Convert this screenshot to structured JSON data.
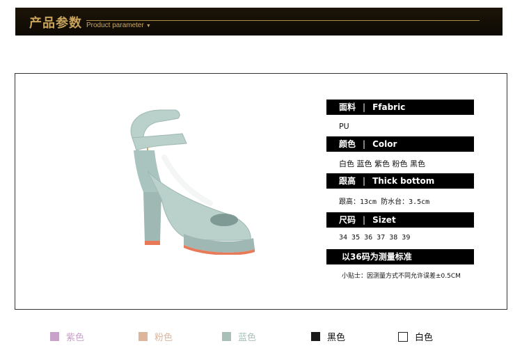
{
  "banner": {
    "title": "产品参数",
    "subtitle": "Product parameter",
    "arrow": "▼"
  },
  "params": [
    {
      "label_cn": "面料",
      "label_en": "Ffabric",
      "value": "PU"
    },
    {
      "label_cn": "颜色",
      "label_en": "Color",
      "value": "白色  蓝色  紫色  粉色  黑色"
    },
    {
      "label_cn": "跟高",
      "label_en": "Thick bottom",
      "value": "跟高：13cm   防水台：3.5cm"
    },
    {
      "label_cn": "尺码",
      "label_en": "Sizet",
      "value": "34  35  36  37  38  39"
    }
  ],
  "standard": {
    "title": "以36码为测量标准",
    "note": "小贴士：因测量方式不同允许误差±0.5CM"
  },
  "separator": "|",
  "swatches": [
    {
      "label": "紫色",
      "color": "#c8a2c8",
      "text_color": "#c8a2c8"
    },
    {
      "label": "粉色",
      "color": "#dcb59b",
      "text_color": "#dcb59b"
    },
    {
      "label": "蓝色",
      "color": "#a8c0b8",
      "text_color": "#a8c0b8"
    },
    {
      "label": "黑色",
      "color": "#1a1a1a",
      "text_color": "#111111"
    },
    {
      "label": "白色",
      "color": "#ffffff",
      "text_color": "#111111"
    }
  ],
  "colors": {
    "shoe_main": "#b9d0cb",
    "shoe_shade": "#9fb8b3",
    "sole": "#e87a5a",
    "banner_gold": "#caa35b"
  }
}
